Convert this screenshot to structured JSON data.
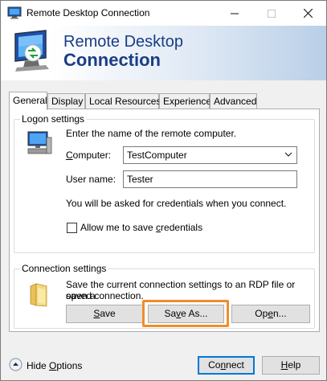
{
  "window": {
    "title": "Remote Desktop Connection",
    "minimize_glyph": "—",
    "maximize_glyph": "☐",
    "close_glyph": "✕"
  },
  "banner": {
    "line1": "Remote Desktop",
    "line2": "Connection",
    "icon": "rdp-monitor-icon"
  },
  "tabs": [
    {
      "label": "General",
      "active": true
    },
    {
      "label": "Display",
      "active": false
    },
    {
      "label": "Local Resources",
      "active": false
    },
    {
      "label": "Experience",
      "active": false
    },
    {
      "label": "Advanced",
      "active": false
    }
  ],
  "logon": {
    "legend": "Logon settings",
    "instruction": "Enter the name of the remote computer.",
    "computer_label_pre": "",
    "computer_label_key": "C",
    "computer_label_post": "omputer:",
    "computer_value": "TestComputer",
    "user_label": "User name:",
    "user_value": "Tester",
    "credentials_note": "You will be asked for credentials when you connect.",
    "save_checkbox_pre": "Allow me to save ",
    "save_checkbox_key": "c",
    "save_checkbox_post": "redentials",
    "save_checkbox_checked": false
  },
  "connection": {
    "legend": "Connection settings",
    "description_line1": "Save the current connection settings to an RDP file or open a",
    "description_line2": "saved connection.",
    "save_key": "S",
    "save_rest": "ave",
    "saveas_pre": "Sa",
    "saveas_key": "v",
    "saveas_post": "e As...",
    "open_pre": "Op",
    "open_key": "e",
    "open_post": "n...",
    "highlight_color": "#f28c2c"
  },
  "footer": {
    "hide_pre": "Hide ",
    "hide_key": "O",
    "hide_post": "ptions",
    "connect_pre": "Co",
    "connect_key": "n",
    "connect_post": "nect",
    "help_key": "H",
    "help_rest": "elp"
  }
}
